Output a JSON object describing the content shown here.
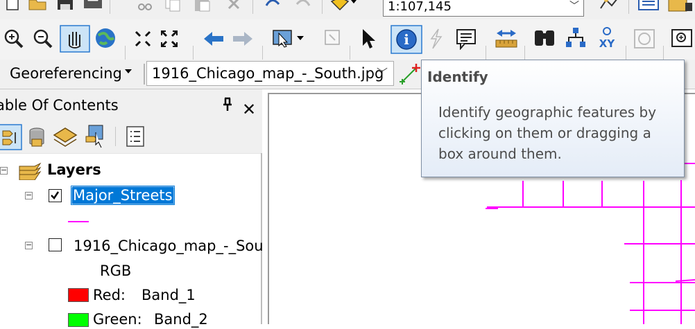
{
  "toolbar_main": {
    "scale_value": "1:107,145",
    "icons": [
      "new-document-icon",
      "open-folder-icon",
      "save-icon",
      "print-icon",
      "cut-icon",
      "copy-icon",
      "paste-icon",
      "delete-icon",
      "undo-icon",
      "redo-icon",
      "add-data-icon",
      "map-scale-dropdown"
    ]
  },
  "toolbar_tools": {
    "icons": [
      "zoom-in-icon",
      "zoom-out-icon",
      "pan-icon",
      "full-extent-icon",
      "fixed-zoom-in-icon",
      "fixed-zoom-out-icon",
      "back-extent-icon",
      "forward-extent-icon",
      "select-features-icon",
      "clear-selection-icon",
      "select-elements-icon",
      "identify-icon",
      "hyperlink-icon",
      "html-popup-icon",
      "measure-icon",
      "find-icon",
      "find-route-icon",
      "go-to-xy-icon",
      "time-slider-icon",
      "viewer-window-icon"
    ],
    "active_tool": "identify-icon"
  },
  "georef": {
    "label": "Georeferencing",
    "layer_value": "1916_Chicago_map_-_South.jpg"
  },
  "toc": {
    "title": "able Of Contents",
    "pin": "ᵠ",
    "close": "✕",
    "layers_group": "Layers",
    "items": [
      {
        "label": "Major_Streets",
        "checked": true,
        "selected": true
      },
      {
        "label": "1916_Chicago_map_-_Sou",
        "checked": false,
        "selected": false
      }
    ],
    "rgb_label": "RGB",
    "bands": [
      {
        "channel": "Red:",
        "band": "Band_1",
        "color": "#ff0000"
      },
      {
        "channel": "Green:",
        "band": "Band_2",
        "color": "#00ff00"
      }
    ],
    "line_symbol_color": "#ff00ff"
  },
  "tooltip": {
    "title": "Identify",
    "body": "Identify geographic features by clicking on them or dragging a box around them."
  },
  "map": {
    "street_color": "#ff00ff"
  }
}
